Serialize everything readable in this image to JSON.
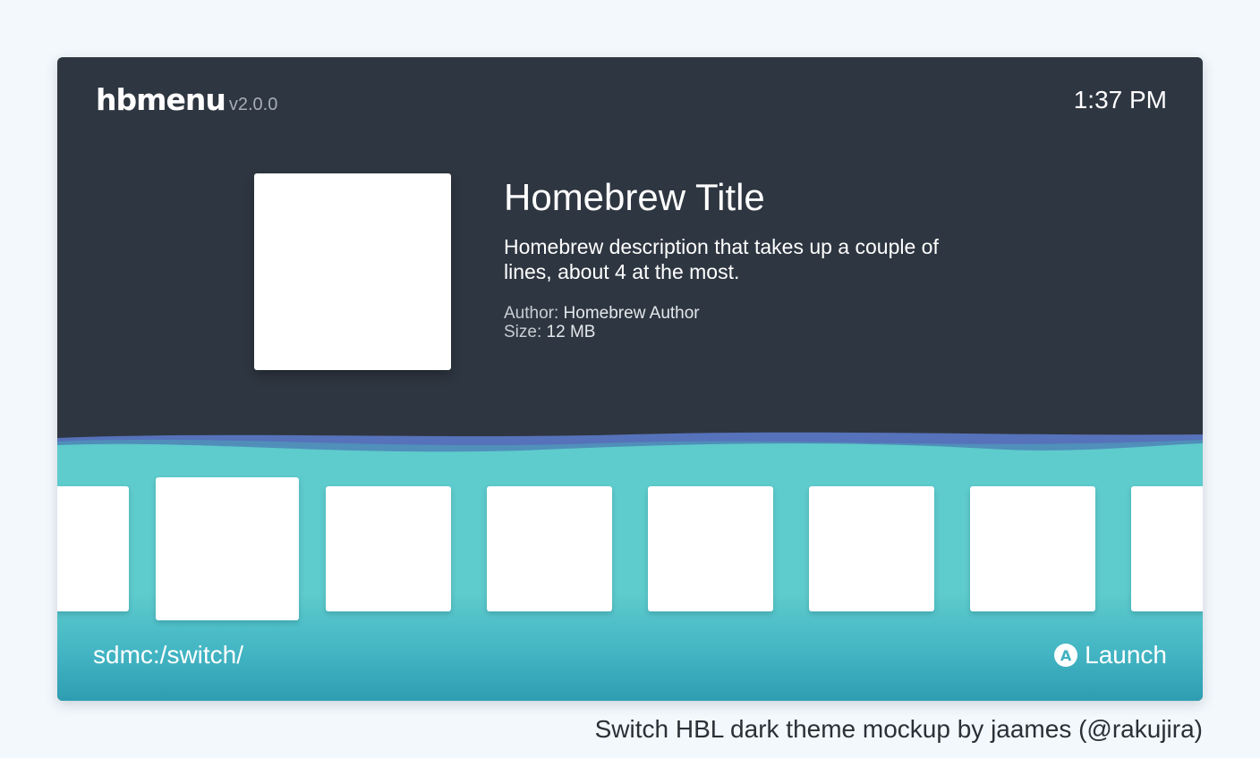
{
  "header": {
    "app_name": "hbmenu",
    "version": "v2.0.0",
    "clock": "1:37 PM"
  },
  "selected_app": {
    "title": "Homebrew Title",
    "description": "Homebrew description that takes up a couple of lines, about 4 at the most.",
    "author_label": "Author:",
    "author_value": "Homebrew Author",
    "size_label": "Size:",
    "size_value": "12 MB"
  },
  "carousel": {
    "tile_count": 8,
    "selected_index": 1
  },
  "footer": {
    "path": "sdmc:/switch/",
    "button_glyph": "A",
    "action_label": "Launch"
  },
  "caption": "Switch HBL dark theme mockup by jaames (@rakujira)",
  "colors": {
    "top_background": "#2e3641",
    "bottom_background": "#5ecbcc",
    "wave_accent": "#5b79c8",
    "tile": "#ffffff",
    "page_background": "#f3f8fc"
  },
  "icons": {
    "action_button": "a-button-icon"
  }
}
